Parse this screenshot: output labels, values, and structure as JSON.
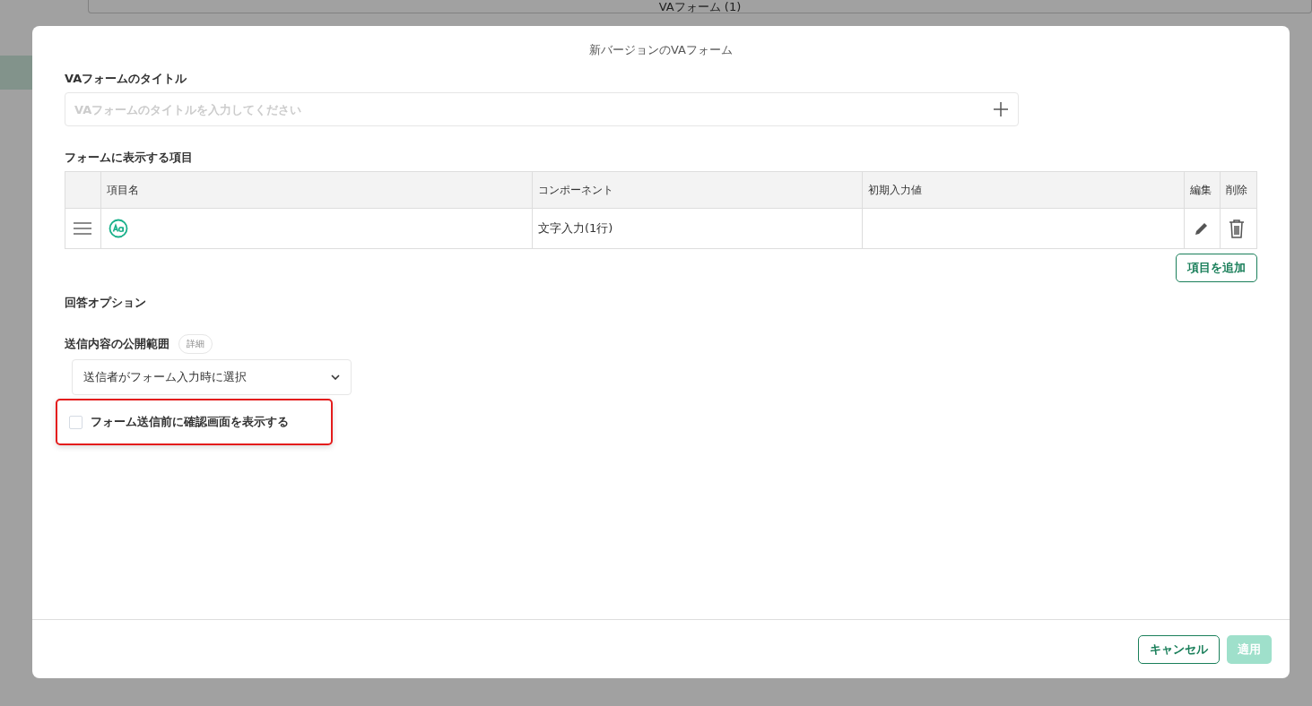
{
  "background_page": {
    "form_button": "VAフォーム (1)"
  },
  "dialog": {
    "title": "新バージョンのVAフォーム",
    "title_field": {
      "label": "VAフォームのタイトル",
      "placeholder": "VAフォームのタイトルを入力してください"
    },
    "items_section": {
      "label": "フォームに表示する項目",
      "columns": [
        "項目名",
        "コンポーネント",
        "初期入力値",
        "編集",
        "削除"
      ],
      "rows": [
        {
          "component": "文字入力(1行)"
        }
      ],
      "add_button": "項目を追加"
    },
    "answer_options": {
      "heading": "回答オプション",
      "visibility_label": "送信内容の公開範囲",
      "details_badge": "詳細",
      "visibility_select": {
        "value": "送信者がフォーム入力時に選択"
      },
      "confirm_checkbox": {
        "label": "フォーム送信前に確認画面を表示する",
        "checked": false,
        "highlighted": true
      }
    },
    "buttons": [
      {
        "label": "キャンセル",
        "kind": "secondary"
      },
      {
        "label": "適用",
        "kind": "primary",
        "disabled": true
      }
    ]
  }
}
